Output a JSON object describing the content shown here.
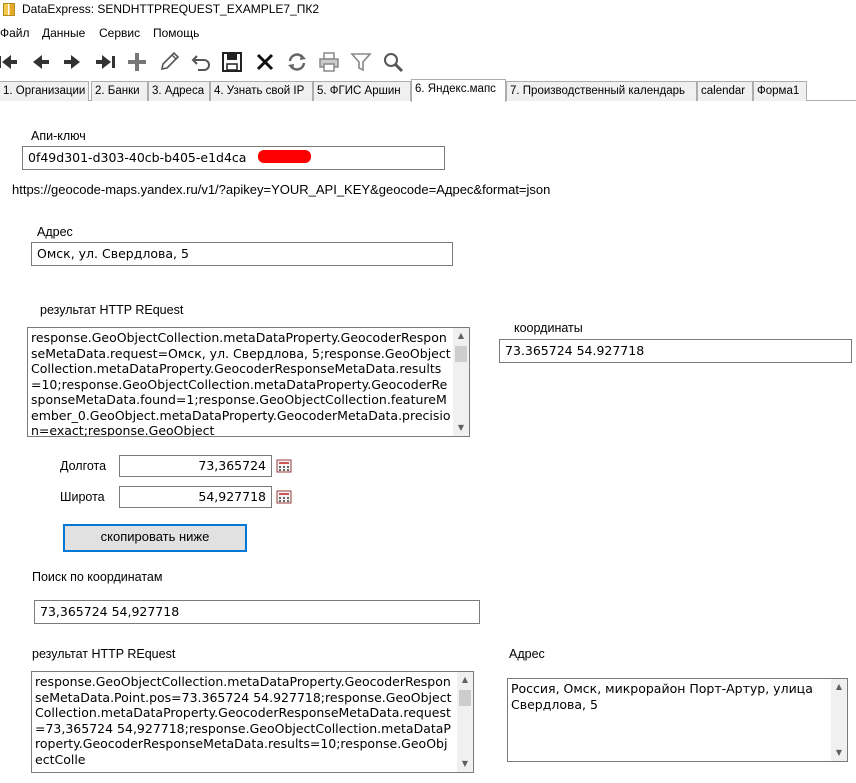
{
  "window": {
    "title": "DataExpress: SENDHTTPREQUEST_EXAMPLE7_ПК2"
  },
  "menu": [
    "Файл",
    "Данные",
    "Сервис",
    "Помощь"
  ],
  "toolbar": {
    "icons": [
      "first-icon",
      "prev-icon",
      "next-icon",
      "last-icon",
      "add-icon",
      "edit-icon",
      "undo-icon",
      "save-icon",
      "delete-icon",
      "refresh-icon",
      "print-icon",
      "filter-icon",
      "search-icon"
    ]
  },
  "tabs": [
    {
      "label": "1. Организации",
      "active": false
    },
    {
      "label": "2. Банки",
      "active": false
    },
    {
      "label": "3. Адреса",
      "active": false
    },
    {
      "label": "4. Узнать свой IP",
      "active": false
    },
    {
      "label": "5. ФГИС Аршин",
      "active": false
    },
    {
      "label": "6. Яндекс.мапс",
      "active": true
    },
    {
      "label": "7. Производственный календарь",
      "active": false
    },
    {
      "label": "calendar",
      "active": false
    },
    {
      "label": "Форма1",
      "active": false
    }
  ],
  "form": {
    "api_key_label": "Апи-ключ",
    "api_key_value": "0f49d301-d303-40cb-b405-e1d4ca",
    "url_template": "https://geocode-maps.yandex.ru/v1/?apikey=YOUR_API_KEY&geocode=Адрес&format=json",
    "address_label": "Адрес",
    "address_value": "Омск, ул. Свердлова, 5",
    "result1_label": "результат HTTP REquest",
    "result1_text": "response.GeoObjectCollection.metaDataProperty.GeocoderResponseMetaData.request=Омск, ул. Свердлова, 5;response.GeoObjectCollection.metaDataProperty.GeocoderResponseMetaData.results=10;response.GeoObjectCollection.metaDataProperty.GeocoderResponseMetaData.found=1;response.GeoObjectCollection.featureMember_0.GeoObject.metaDataProperty.GeocoderMetaData.precision=exact;response.GeoObject",
    "coords_label": "координаты",
    "coords_value": "73.365724 54.927718",
    "lon_label": "Долгота",
    "lon_value": "73,365724",
    "lat_label": "Широта",
    "lat_value": "54,927718",
    "copy_button": "скопировать ниже",
    "reverse_label": "Поиск по координатам",
    "reverse_value": "73,365724 54,927718",
    "result2_label": "результат HTTP REquest",
    "result2_text": "response.GeoObjectCollection.metaDataProperty.GeocoderResponseMetaData.Point.pos=73.365724 54.927718;response.GeoObjectCollection.metaDataProperty.GeocoderResponseMetaData.request=73,365724 54,927718;response.GeoObjectCollection.metaDataProperty.GeocoderResponseMetaData.results=10;response.GeoObjectColle",
    "address2_label": "Адрес",
    "address2_value": "Россия, Омск, микрорайон Порт-Артур, улица Свердлова, 5"
  },
  "colors": {
    "focus_border": "#0078d7",
    "redaction": "#ff0000"
  }
}
